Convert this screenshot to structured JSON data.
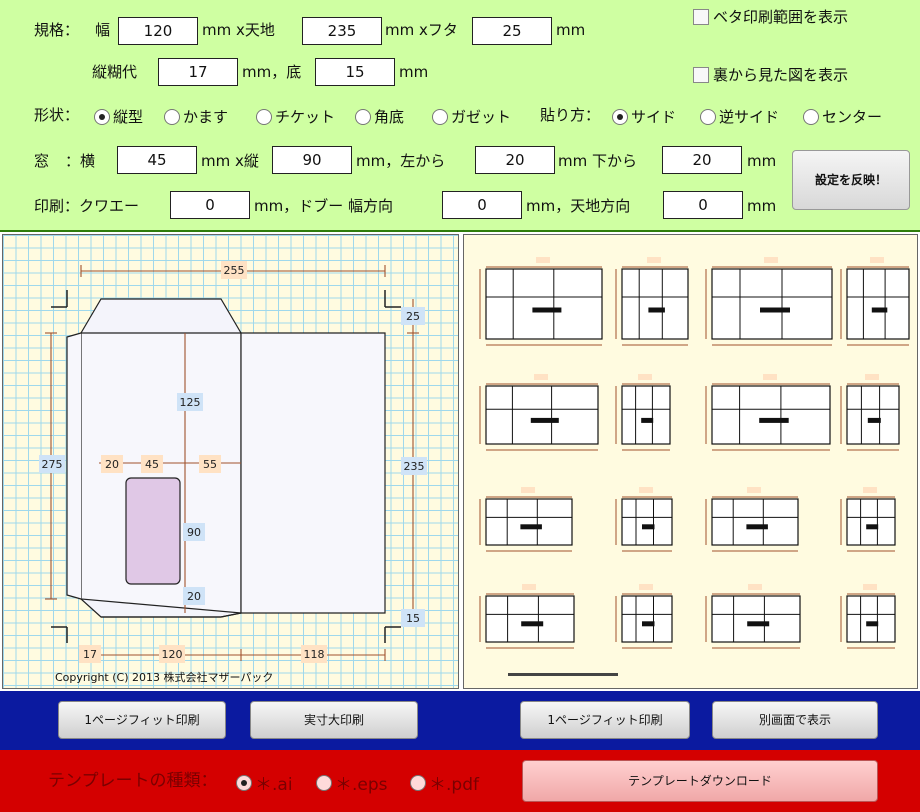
{
  "settings": {
    "size_label": "規格：",
    "width_label": "幅",
    "width_value": "120",
    "mm_x_height": "mm x天地",
    "height_value": "235",
    "mm_x_flap": "mm xフタ",
    "flap_value": "25",
    "mm": "mm",
    "vglue_label": "縦糊代",
    "vglue_value": "17",
    "mm_bottom": "mm，底",
    "bottom_value": "15",
    "show_solid_print": "ベタ印刷範囲を表示",
    "show_back_view": "裏から見た図を表示",
    "shape_label": "形状：",
    "shape_options": [
      "縦型",
      "かます",
      "チケット",
      "角底",
      "ガゼット"
    ],
    "shape_selected": "縦型",
    "paste_label": "貼り方：",
    "paste_options": [
      "サイド",
      "逆サイド",
      "センター"
    ],
    "paste_selected": "サイド",
    "window_label": "窓",
    "window_w_label": "：横",
    "window_w_value": "45",
    "mm_x_vert": "mm x縦",
    "window_h_value": "90",
    "mm_from_left": "mm，左から",
    "window_left_value": "20",
    "mm_from_bottom": "mm 下から",
    "window_bottom_value": "20",
    "apply_button": "設定を反映！",
    "print_label": "印刷：クワエー",
    "grip_value": "0",
    "bleed_label": "mm，ドブー 幅方向",
    "bleed_w_value": "0",
    "bleed_h_label": "mm，天地方向",
    "bleed_h_value": "0"
  },
  "diagram": {
    "dim_total_width": "255",
    "dim_flap": "25",
    "dim_total_height": "275",
    "dim_height": "235",
    "dim_window_top": "125",
    "dim_window_left": "20",
    "dim_window_width": "45",
    "dim_window_right": "55",
    "dim_window_height": "90",
    "dim_window_bottom": "20",
    "dim_bottom": "15",
    "dim_glue": "17",
    "dim_width": "120",
    "dim_back": "118",
    "copyright": "Copyright (C) 2013 株式会社マザーパック"
  },
  "toolbar": {
    "fit_print_left": "1ページフィット印刷",
    "actual_print": "実寸大印刷",
    "fit_print_right": "1ページフィット印刷",
    "open_new_window": "別画面で表示"
  },
  "download": {
    "template_type_label": "テンプレートの種類：",
    "formats": [
      "＊.ai",
      "＊.eps",
      "＊.pdf"
    ],
    "selected_format": "＊.ai",
    "download_button": "テンプレートダウンロード"
  },
  "colors": {
    "settings_bg": "#cfffa2",
    "blue_bar": "#0b1aa0",
    "red_bar": "#d40000",
    "window_fill": "#e0c8e6",
    "dim_line": "#a0522d"
  }
}
